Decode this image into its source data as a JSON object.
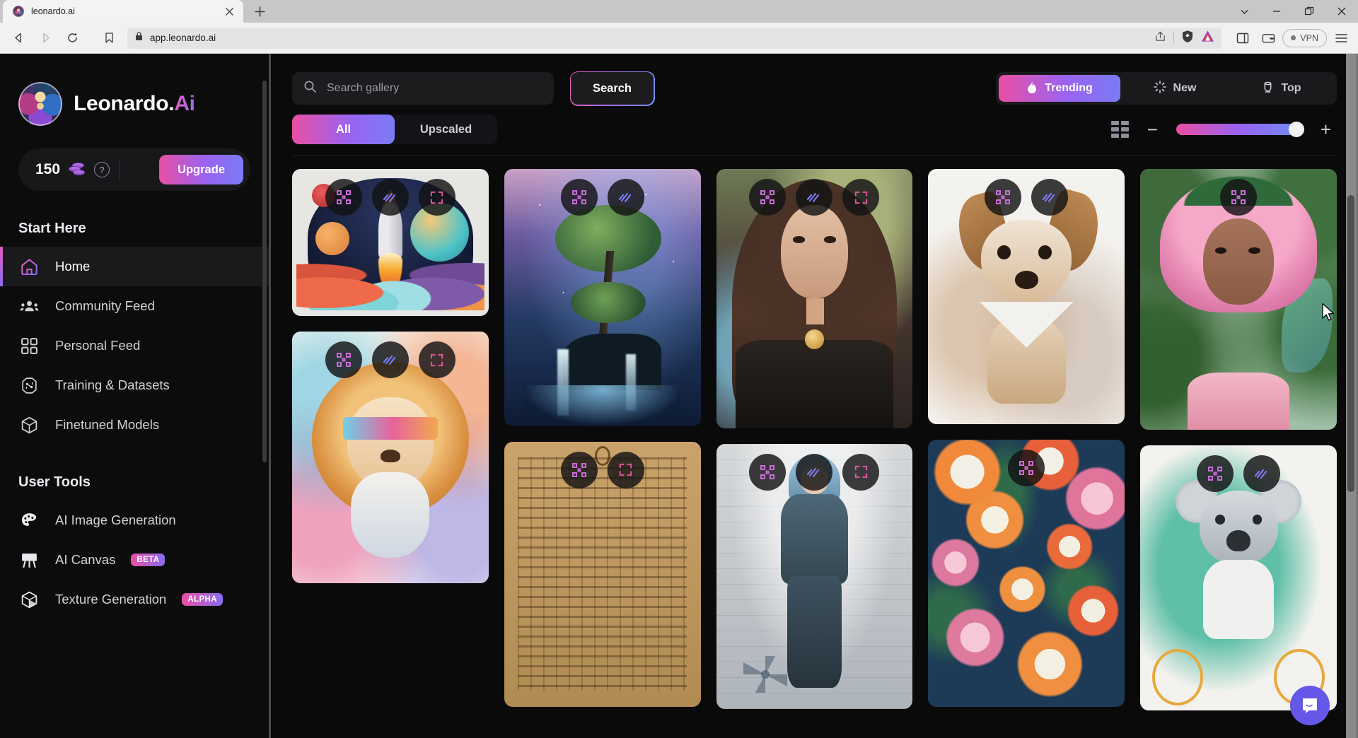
{
  "browser": {
    "tab": {
      "title": "leonardo.ai",
      "favicon": "leonardo-favicon-icon",
      "close": "×"
    },
    "new_tab_label": "+",
    "window_controls": {
      "chevron": "⌄",
      "minimize": "—",
      "restore": "❐",
      "close": "✕"
    },
    "nav": {
      "back": "◁",
      "forward": "▷",
      "reload": "⟳",
      "bookmark": "bookmark-icon"
    },
    "omnibox": {
      "lock": "lock-icon",
      "url": "app.leonardo.ai",
      "share": "share-icon",
      "brave_shield": "brave-shield-icon",
      "bat_rewards": "bat-triangle-icon"
    },
    "toolbar_right": {
      "sidepanel": "side-panel-icon",
      "wallet": "wallet-icon",
      "vpn_label": "VPN",
      "menu": "hamburger-menu-icon"
    }
  },
  "sidebar": {
    "brand": {
      "name": "Leonardo.",
      "suffix": "Ai",
      "logo": "leonardo-logo-icon"
    },
    "credits": {
      "amount": "150",
      "coin_icon": "coins-icon",
      "help": "?",
      "upgrade_label": "Upgrade"
    },
    "sections": [
      {
        "label": "Start Here",
        "items": [
          {
            "label": "Home",
            "icon": "home-icon",
            "active": true,
            "badge": null
          },
          {
            "label": "Community Feed",
            "icon": "people-icon",
            "active": false,
            "badge": null
          },
          {
            "label": "Personal Feed",
            "icon": "grid-squares-icon",
            "active": false,
            "badge": null
          },
          {
            "label": "Training & Datasets",
            "icon": "training-chip-icon",
            "active": false,
            "badge": null
          },
          {
            "label": "Finetuned Models",
            "icon": "cube-icon",
            "active": false,
            "badge": null
          }
        ]
      },
      {
        "label": "User Tools",
        "items": [
          {
            "label": "AI Image Generation",
            "icon": "palette-icon",
            "active": false,
            "badge": null
          },
          {
            "label": "AI Canvas",
            "icon": "easel-icon",
            "active": false,
            "badge": "BETA"
          },
          {
            "label": "Texture Generation",
            "icon": "texture-cube-icon",
            "active": false,
            "badge": "ALPHA"
          }
        ]
      }
    ]
  },
  "main": {
    "search": {
      "placeholder": "Search gallery",
      "value": "",
      "icon": "search-icon",
      "button_label": "Search"
    },
    "filter_tabs": [
      {
        "label": "All",
        "active": true
      },
      {
        "label": "Upscaled",
        "active": false
      }
    ],
    "sort_tabs": [
      {
        "label": "Trending",
        "icon": "flame-icon",
        "active": true
      },
      {
        "label": "New",
        "icon": "sparkle-icon",
        "active": false
      },
      {
        "label": "Top",
        "icon": "trophy-icon",
        "active": false
      }
    ],
    "zoom": {
      "grid_icon": "grid-density-icon",
      "minus": "−",
      "plus": "+",
      "value": 100
    },
    "gallery": {
      "card_actions": [
        {
          "name": "upscale-icon",
          "title": "Upscale"
        },
        {
          "name": "motion-icon",
          "title": "Motion"
        },
        {
          "name": "expand-icon",
          "title": "Expand"
        }
      ],
      "items": [
        {
          "id": "rocket-launch-poster",
          "art": "art-rocket",
          "ratio": 75,
          "actions": 3,
          "column": 1
        },
        {
          "id": "lion-sunglasses-watercolor",
          "art": "art-lion",
          "ratio": 128,
          "actions": 3,
          "column": 1
        },
        {
          "id": "galaxy-tree-waterfall",
          "art": "art-tree",
          "ratio": 131,
          "actions": 2,
          "column": 2
        },
        {
          "id": "egyptian-papyrus-scroll",
          "art": "art-papyrus",
          "ratio": 135,
          "actions": 2,
          "column": 2
        },
        {
          "id": "bohemian-woman-portrait",
          "art": "art-woman",
          "ratio": 132,
          "actions": 3,
          "column": 3
        },
        {
          "id": "blue-hair-warrior-sheet",
          "art": "art-warrior",
          "ratio": 135,
          "actions": 3,
          "column": 3
        },
        {
          "id": "chihuahua-watercolor",
          "art": "art-dog",
          "ratio": 130,
          "actions": 2,
          "column": 4
        },
        {
          "id": "floral-pattern-dark",
          "art": "art-floral",
          "ratio": 136,
          "actions": 1,
          "column": 4
        },
        {
          "id": "pink-hair-fairy",
          "art": "art-fairy",
          "ratio": 133,
          "actions": 1,
          "column": 5
        },
        {
          "id": "koala-on-bicycle",
          "art": "art-koala",
          "ratio": 135,
          "actions": 2,
          "column": 5
        }
      ]
    },
    "chat_widget": {
      "icon": "intercom-chat-icon",
      "color": "#6558e8"
    }
  },
  "colors": {
    "accent_pink": "#e94fa4",
    "accent_purple": "#9a63f0",
    "accent_blue": "#7b7bf5",
    "page_bg": "#0a0a0a",
    "sidebar_bg": "#0c0c0c"
  }
}
